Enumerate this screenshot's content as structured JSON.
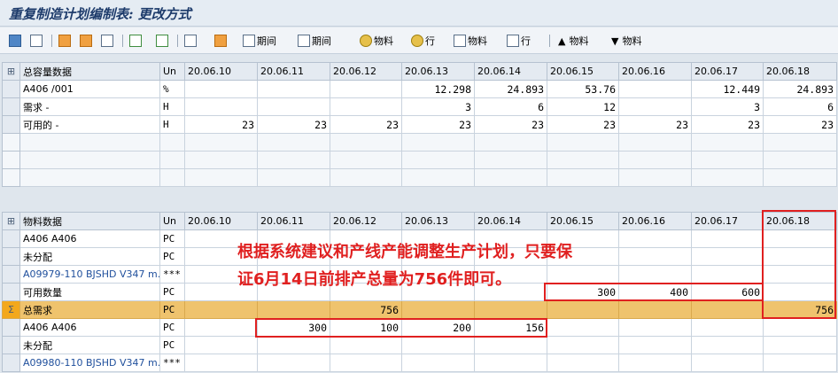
{
  "window": {
    "title": "重复制造计划编制表: 更改方式"
  },
  "toolbar": {
    "btn_period1": "期间",
    "btn_period2": "期间",
    "btn_material1": "物料",
    "btn_row1": "行",
    "btn_material2": "物料",
    "btn_row2": "行",
    "btn_material_up": "物料",
    "btn_material_down": "物料",
    "arrow_up": "▲",
    "arrow_down": "▼"
  },
  "capacity": {
    "header": {
      "name": "总容量数据",
      "unit": "Un",
      "dates": [
        "20.06.10",
        "20.06.11",
        "20.06.12",
        "20.06.13",
        "20.06.14",
        "20.06.15",
        "20.06.16",
        "20.06.17",
        "20.06.18"
      ]
    },
    "rows": [
      {
        "name": "A406 /001",
        "unit": "%",
        "values": [
          "",
          "",
          "",
          "12.298",
          "24.893",
          "53.76",
          "",
          "12.449",
          "24.893"
        ]
      },
      {
        "name": "需求     -",
        "unit": "H",
        "values": [
          "",
          "",
          "",
          "3",
          "6",
          "12",
          "",
          "3",
          "6"
        ]
      },
      {
        "name": "可用的   -",
        "unit": "H",
        "values": [
          "23",
          "23",
          "23",
          "23",
          "23",
          "23",
          "23",
          "23",
          "23"
        ]
      }
    ]
  },
  "material": {
    "header": {
      "name": "物料数据",
      "unit": "Un",
      "dates": [
        "20.06.10",
        "20.06.11",
        "20.06.12",
        "20.06.13",
        "20.06.14",
        "20.06.15",
        "20.06.16",
        "20.06.17",
        "20.06.18"
      ]
    },
    "rows": [
      {
        "name": "A406 A406",
        "unit": "PC",
        "values": [
          "",
          "",
          "",
          "",
          "",
          "",
          "",
          "",
          ""
        ],
        "blue": false
      },
      {
        "name": "未分配",
        "unit": "PC",
        "values": [
          "",
          "",
          "",
          "",
          "",
          "",
          "",
          "",
          ""
        ],
        "blue": false
      },
      {
        "name": "A09979-110 BJSHD V347 m...",
        "unit": "***",
        "values": [
          "",
          "",
          "",
          "",
          "",
          "",
          "",
          "",
          ""
        ],
        "blue": true
      },
      {
        "name": "可用数量",
        "unit": "PC",
        "values": [
          "",
          "",
          "",
          "",
          "",
          "300",
          "400",
          "600",
          ""
        ],
        "blue": false
      },
      {
        "name": "总需求",
        "unit": "PC",
        "values": [
          "",
          "",
          "756",
          "",
          "",
          "",
          "",
          "",
          "756"
        ],
        "blue": false,
        "sum": true
      },
      {
        "name": "A406 A406",
        "unit": "PC",
        "values": [
          "",
          "300",
          "100",
          "200",
          "156",
          "",
          "",
          "",
          ""
        ],
        "blue": false
      },
      {
        "name": "未分配",
        "unit": "PC",
        "values": [
          "",
          "",
          "",
          "",
          "",
          "",
          "",
          "",
          ""
        ],
        "blue": false
      },
      {
        "name": "A09980-110 BJSHD V347 m...",
        "unit": "***",
        "values": [
          "",
          "",
          "",
          "",
          "",
          "",
          "",
          "",
          ""
        ],
        "blue": true
      }
    ]
  },
  "annotation": {
    "line1": "根据系统建议和产线产能调整生产计划，只要保",
    "line2": "证6月14日前排产总量为756件即可。"
  },
  "colors": {
    "annot_red": "#e02020",
    "sum_row": "#efc36d",
    "header_bg": "#e4eaf1"
  }
}
